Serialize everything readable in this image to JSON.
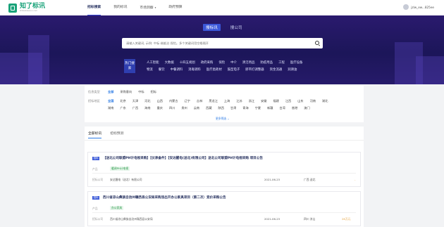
{
  "header": {
    "logo_name": "知了标讯",
    "logo_sub": "zhiliaobiaoxun.com",
    "nav": [
      {
        "label": "招标搜索",
        "active": true,
        "dropdown": false
      },
      {
        "label": "我的标讯",
        "active": false,
        "dropdown": false
      },
      {
        "label": "市场洞察",
        "active": false,
        "dropdown": true
      },
      {
        "label": "政府预算",
        "active": false,
        "dropdown": false
      }
    ],
    "username": "jzlw_ew...825ee"
  },
  "search": {
    "tabs": [
      {
        "label": "搜标讯",
        "active": true
      },
      {
        "label": "搜公司",
        "active": false
      }
    ],
    "placeholder": "请输入关键词, 示例: 中标 继维治 保险。多个关键词用空格隔开",
    "hot_label": "热门搜索",
    "hot_rows": [
      [
        "人工智能",
        "大数据",
        "十四五规划",
        "政府采购",
        "保险",
        "中介",
        "清洁用品",
        "防疫用品",
        "工程",
        "医疗设备"
      ],
      [
        "物流",
        "餐饮",
        "中餐调料",
        "消毒调料",
        "医疗类耗材",
        "鼓型电子",
        "脐带灯调整器",
        "资金流通",
        "润滑油"
      ]
    ]
  },
  "filter": {
    "type_label": "信息类型",
    "type_options": [
      {
        "label": "全部",
        "selected": true
      },
      {
        "label": "采购意向",
        "selected": false
      },
      {
        "label": "中标",
        "selected": false
      },
      {
        "label": "招标",
        "selected": false
      }
    ],
    "region_label": "招标地区",
    "region_row1": [
      {
        "label": "全国",
        "selected": true
      },
      {
        "label": "北京"
      },
      {
        "label": "天津"
      },
      {
        "label": "河北"
      },
      {
        "label": "山西"
      },
      {
        "label": "内蒙古"
      },
      {
        "label": "辽宁"
      },
      {
        "label": "吉林"
      },
      {
        "label": "黑龙江"
      },
      {
        "label": "上海"
      },
      {
        "label": "江苏"
      },
      {
        "label": "浙江"
      },
      {
        "label": "安徽"
      },
      {
        "label": "福建"
      },
      {
        "label": "江西"
      },
      {
        "label": "山东"
      },
      {
        "label": "河南"
      },
      {
        "label": "湖北"
      }
    ],
    "region_row2": [
      {
        "label": "湖南"
      },
      {
        "label": "广东"
      },
      {
        "label": "广西"
      },
      {
        "label": "海南"
      },
      {
        "label": "重庆"
      },
      {
        "label": "四川"
      },
      {
        "label": "贵州"
      },
      {
        "label": "云南"
      },
      {
        "label": "西藏"
      },
      {
        "label": "陕西"
      },
      {
        "label": "甘肃"
      },
      {
        "label": "青海"
      },
      {
        "label": "宁夏"
      },
      {
        "label": "新疆"
      },
      {
        "label": "台湾"
      },
      {
        "label": "香港"
      },
      {
        "label": "澳门"
      }
    ],
    "more_label": "更多筛选 ⌄"
  },
  "results": {
    "tabs": [
      {
        "label": "全部标讯",
        "active": true
      },
      {
        "label": "招标预测",
        "active": false
      }
    ],
    "items": [
      {
        "badge": "招标",
        "title": "【送北公司联盟PH计电视采购】【仪表备件】【安达醒电(送北)有限公司】送北公司联盟PH计电视采购 项目公告",
        "product_label": "产品",
        "product": "暖调PH计电视",
        "unit_label": "招标公司",
        "unit": "安达醒电（送北）有限公司",
        "date": "2021-06-23",
        "region": "广西 送北",
        "amount": "-"
      },
      {
        "badge": "招标",
        "title": "西川省凉山彝族自治州赣西县公安局采购洛出开办公家具项目（第二次）竞价采购公告",
        "product_label": "产品",
        "product": "办公家具",
        "unit_label": "招标公司",
        "unit": "西川省凉山彝族自治州赣西县公安局",
        "date": "2021-06-23",
        "region": "四川 凉山",
        "amount": "26万元"
      }
    ]
  }
}
